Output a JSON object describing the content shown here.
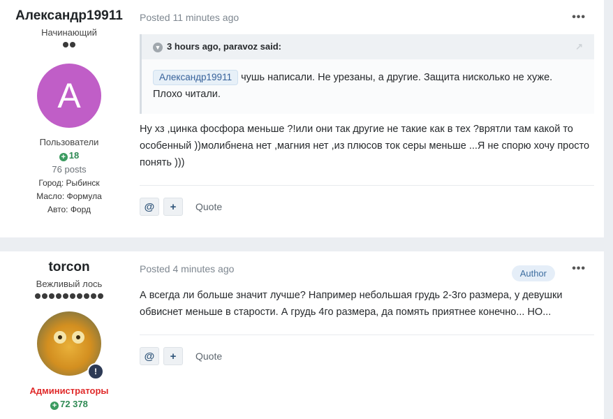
{
  "posts": [
    {
      "author": "Александр19911",
      "rank": "Начинающий",
      "pips": 2,
      "avatar_letter": "A",
      "avatar_color": "#c05ec7",
      "group": "Пользователи",
      "reputation": "18",
      "post_count": "76 posts",
      "fields": [
        {
          "key": "Город:",
          "value": "Рыбинск"
        },
        {
          "key": "Масло:",
          "value": "Формула"
        },
        {
          "key": "Авто:",
          "value": "Форд"
        }
      ],
      "posted": "Posted 11 minutes ago",
      "more_label": "•••",
      "quote": {
        "header": "3 hours ago, paravoz said:",
        "mention": "Александр19911",
        "text": " чушь написали. Не урезаны, а другие. Защита нисколько не хуже. Плохо читали."
      },
      "text": "Ну хз ,цинка фосфора меньше ?!или они так другие не такие как в тех ?врятли там какой то особенный ))молибнена нет ,магния нет  ,из плюсов ток серы меньше ...Я не спорю хочу просто понять )))",
      "actions": {
        "mention": "@",
        "multiquote": "+",
        "quote": "Quote"
      }
    },
    {
      "author": "torcon",
      "rank": "Вежливый лось",
      "pips": 10,
      "badge": "Author",
      "group": "Администраторы",
      "reputation": "72 378",
      "posted": "Posted 4 minutes ago",
      "more_label": "•••",
      "text": "А всегда ли больше значит лучше? Например небольшая грудь 2-3го размера, у девушки обвиснет меньше в старости. А грудь 4го размера, да помять приятнее конечно... НО...",
      "actions": {
        "mention": "@",
        "multiquote": "+",
        "quote": "Quote"
      }
    }
  ]
}
